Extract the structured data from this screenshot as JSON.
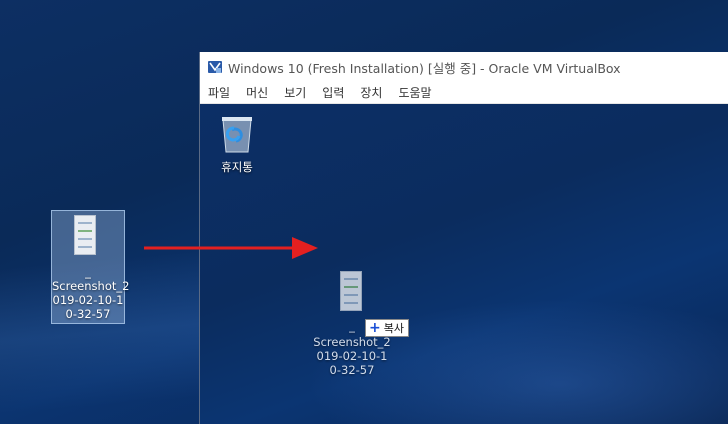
{
  "vbox": {
    "title": "Windows 10 (Fresh Installation) [실행 중] - Oracle VM VirtualBox",
    "menu": [
      "파일",
      "머신",
      "보기",
      "입력",
      "장치",
      "도움말"
    ]
  },
  "guest_desktop": {
    "recycle_bin_label": "휴지통",
    "dragged_file": {
      "label_lines": [
        "_",
        "Screenshot_2",
        "019-02-10-1",
        "0-32-57"
      ],
      "copy_tooltip": "복사"
    }
  },
  "host_desktop": {
    "file": {
      "label_lines": [
        "_",
        "Screenshot_2",
        "019-02-10-1",
        "0-32-57"
      ]
    }
  },
  "colors": {
    "arrow": "#e32020",
    "copy_plus": "#1a4fd6"
  },
  "icons": [
    "virtualbox-icon",
    "recycle-bin-icon",
    "image-file-icon",
    "plus-icon",
    "arrow-icon"
  ]
}
